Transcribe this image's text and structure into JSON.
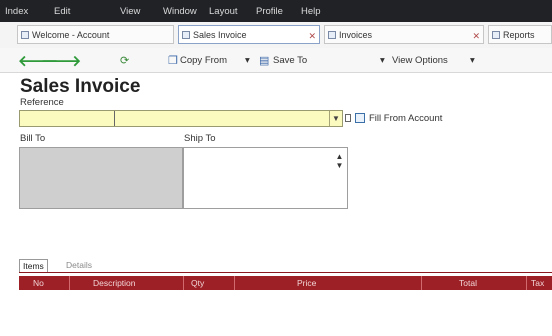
{
  "menu": [
    "Index",
    "Edit",
    "View",
    "Window",
    "Layout",
    "Profile",
    "Help"
  ],
  "tabs": [
    {
      "label": "Welcome - Account"
    },
    {
      "label": "Sales Invoice"
    },
    {
      "label": "Invoices"
    },
    {
      "label": "Reports"
    }
  ],
  "toolbar": {
    "copy_from": "Copy From",
    "save_to": "Save To",
    "view_options": "View Options"
  },
  "page": {
    "title": "Sales Invoice",
    "reference_label": "Reference",
    "reference_value": "",
    "fill_label": "Fill From Account",
    "bill_to_label": "Bill To",
    "ship_to_label": "Ship To"
  },
  "bottom_tabs": [
    "Items",
    "Details"
  ],
  "grid": {
    "columns": [
      "No",
      "Description",
      "Qty",
      "Price",
      "Total",
      "Tax"
    ]
  },
  "colors": {
    "menubar": "#202226",
    "reference_field": "#fbfbbf",
    "grid_header": "#9d2027",
    "bill_to_box": "#cfcfcf"
  }
}
